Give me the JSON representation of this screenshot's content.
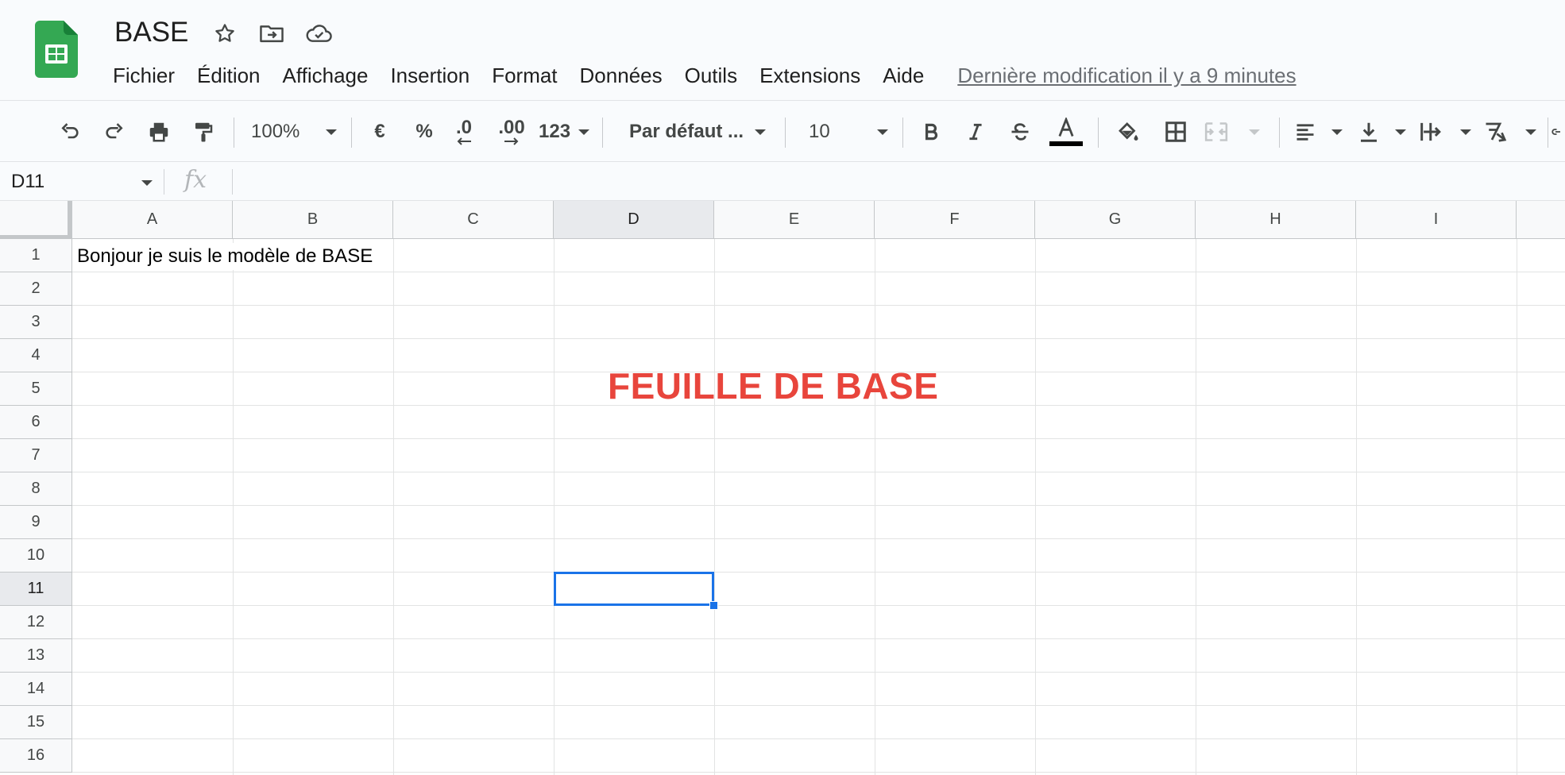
{
  "header": {
    "title": "BASE",
    "menu": [
      "Fichier",
      "Édition",
      "Affichage",
      "Insertion",
      "Format",
      "Données",
      "Outils",
      "Extensions",
      "Aide"
    ],
    "last_edit": "Dernière modification il y a 9 minutes"
  },
  "toolbar": {
    "zoom": "100%",
    "currency": "€",
    "percent": "%",
    "decrease_decimal": ".0",
    "increase_decimal": ".00",
    "more_formats": "123",
    "font": "Par défaut ...",
    "font_size": "10",
    "text_color": "#000000"
  },
  "formula_bar": {
    "name_box": "D11",
    "fx": "fx",
    "content": ""
  },
  "sheet": {
    "columns": [
      "A",
      "B",
      "C",
      "D",
      "E",
      "F",
      "G",
      "H",
      "I"
    ],
    "rows": [
      "1",
      "2",
      "3",
      "4",
      "5",
      "6",
      "7",
      "8",
      "9",
      "10",
      "11",
      "12",
      "13",
      "14",
      "15",
      "16"
    ],
    "active_cell": "D11",
    "active_column": "D",
    "active_row": "11",
    "cell_a1": "Bonjour je suis le modèle de BASE",
    "banner_text": "FEUILLE DE BASE",
    "banner_color": "#e8453c",
    "selection_color": "#1a73e8"
  }
}
